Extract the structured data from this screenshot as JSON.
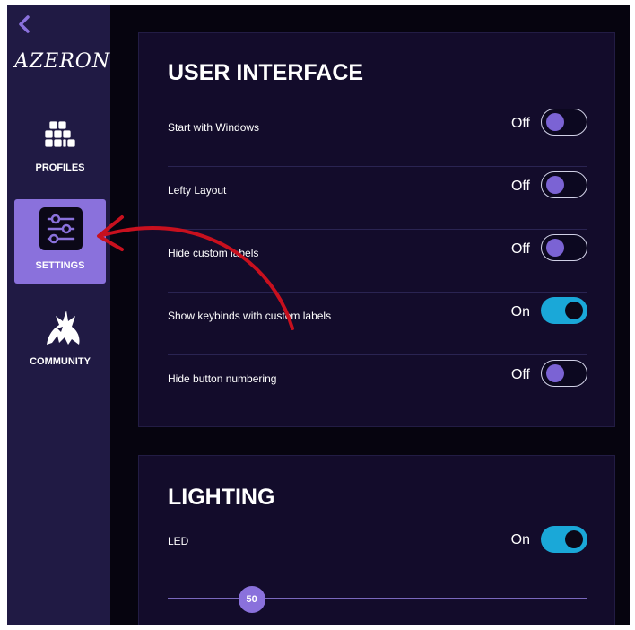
{
  "sidebar": {
    "logo_text": "AZERON",
    "items": [
      {
        "label": "PROFILES",
        "icon": "grid-icon"
      },
      {
        "label": "SETTINGS",
        "icon": "sliders-icon",
        "active": true
      },
      {
        "label": "COMMUNITY",
        "icon": "dragon-icon"
      }
    ]
  },
  "user_interface": {
    "title": "USER INTERFACE",
    "settings": [
      {
        "label": "Start with Windows",
        "state": "Off"
      },
      {
        "label": "Lefty Layout",
        "state": "Off"
      },
      {
        "label": "Hide custom labels",
        "state": "Off"
      },
      {
        "label": "Show keybinds with custom labels",
        "state": "On"
      },
      {
        "label": "Hide button numbering",
        "state": "Off"
      }
    ]
  },
  "lighting": {
    "title": "LIGHTING",
    "led": {
      "label": "LED",
      "state": "On"
    },
    "brightness_value": "50",
    "brightness_fraction": 0.2
  },
  "colors": {
    "sidebar_bg": "#201a44",
    "panel_bg": "#130c2b",
    "accent_purple": "#8a71dc",
    "toggle_on": "#1aa8d8",
    "annotation_red": "#c8101e"
  }
}
